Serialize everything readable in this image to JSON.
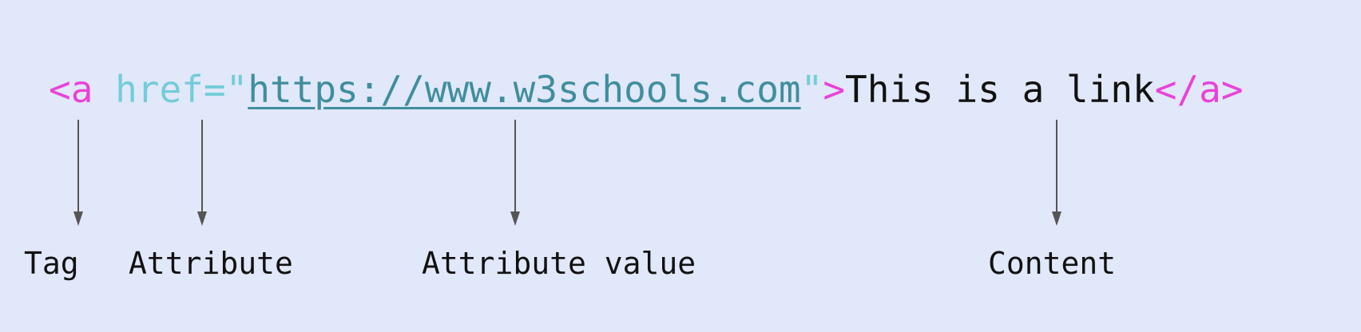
{
  "code": {
    "tag_open": "<a",
    "space": " ",
    "attr_name": "href=\"",
    "attr_value": "https://www.w3schools.com",
    "attr_close": "\"",
    "tag_open_end": ">",
    "content": "This is a link",
    "tag_close": "</a>"
  },
  "labels": {
    "tag": "Tag",
    "attribute": "Attribute",
    "attribute_value": "Attribute value",
    "content": "Content"
  },
  "colors": {
    "background": "#e1e8f9",
    "tag": "#e843d8",
    "attribute": "#73ccd9",
    "attribute_value": "#3f8e9e",
    "text": "#111111",
    "arrow": "#555555"
  }
}
